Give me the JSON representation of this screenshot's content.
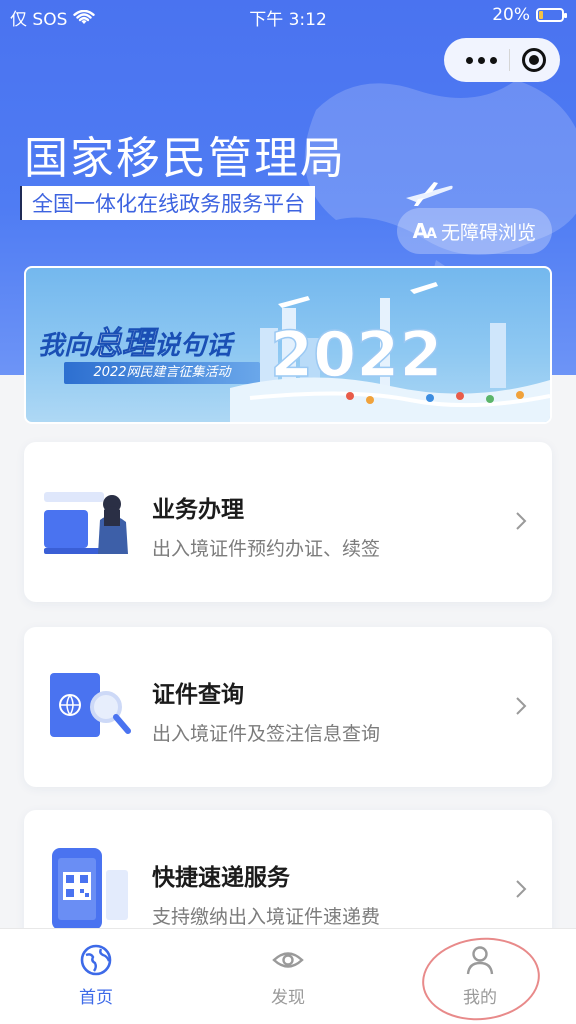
{
  "status_bar": {
    "carrier": "仅 SOS",
    "time": "下午 3:12",
    "battery": "20%",
    "battery_level": 0.2
  },
  "capsule": {
    "more_icon": "more-dots-icon",
    "close_icon": "target-circle-icon"
  },
  "header": {
    "title": "国家移民管理局",
    "subtitle": "全国一体化在线政务服务平台",
    "accessibility_prefix": "A",
    "accessibility_prefix_small": "A",
    "accessibility_label": "无障碍浏览"
  },
  "banner": {
    "title_part1": "我向",
    "title_big": "总理",
    "title_part2": "说句话",
    "subtitle": "2022网民建言征集活动",
    "art_year": "2022"
  },
  "cards": [
    {
      "title": "业务办理",
      "desc": "出入境证件预约办证、续签",
      "icon": "person-laptop-icon"
    },
    {
      "title": "证件查询",
      "desc": "出入境证件及签注信息查询",
      "icon": "passport-search-icon"
    },
    {
      "title": "快捷速递服务",
      "desc": "支持缴纳出入境证件速递费",
      "icon": "phone-qrcode-icon"
    }
  ],
  "tabbar": {
    "items": [
      {
        "label": "首页",
        "icon": "globe-icon",
        "active": true
      },
      {
        "label": "发现",
        "icon": "eye-icon",
        "active": false
      },
      {
        "label": "我的",
        "icon": "user-icon",
        "active": false
      }
    ]
  },
  "colors": {
    "primary": "#4a73f0",
    "active_tab": "#3d6ae8",
    "annotation": "#e88a8a"
  }
}
